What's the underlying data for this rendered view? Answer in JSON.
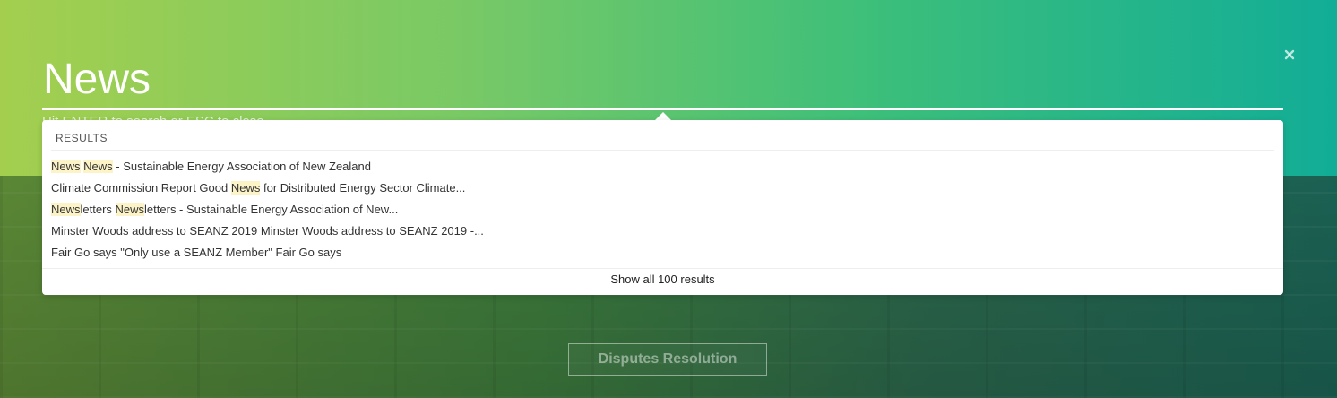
{
  "search": {
    "value": "News",
    "hint": "Hit ENTER to search or ESC to close",
    "close_icon": "close-icon"
  },
  "results": {
    "heading": "RESULTS",
    "items": [
      {
        "segments": [
          {
            "t": "News",
            "h": true
          },
          {
            "t": " ",
            "h": false
          },
          {
            "t": "News",
            "h": true
          },
          {
            "t": " - Sustainable Energy Association of New Zealand",
            "h": false
          }
        ]
      },
      {
        "segments": [
          {
            "t": "Climate Commission Report Good ",
            "h": false
          },
          {
            "t": "News",
            "h": true
          },
          {
            "t": " for Distributed Energy Sector Climate...",
            "h": false
          }
        ]
      },
      {
        "segments": [
          {
            "t": "News",
            "h": true
          },
          {
            "t": "letters ",
            "h": false
          },
          {
            "t": "News",
            "h": true
          },
          {
            "t": "letters - Sustainable Energy Association of New...",
            "h": false
          }
        ]
      },
      {
        "segments": [
          {
            "t": "Minster Woods address to SEANZ 2019 Minster Woods address to SEANZ 2019 -...",
            "h": false
          }
        ]
      },
      {
        "segments": [
          {
            "t": "Fair Go says \"Only use a SEANZ Member\" Fair Go says",
            "h": false
          }
        ]
      }
    ],
    "show_all": "Show all 100 results"
  },
  "page": {
    "disputes_button": "Disputes Resolution"
  },
  "colors": {
    "highlight": "#fcf3c7",
    "gradient_start": "#a4cf4e",
    "gradient_end": "#12ad97"
  }
}
